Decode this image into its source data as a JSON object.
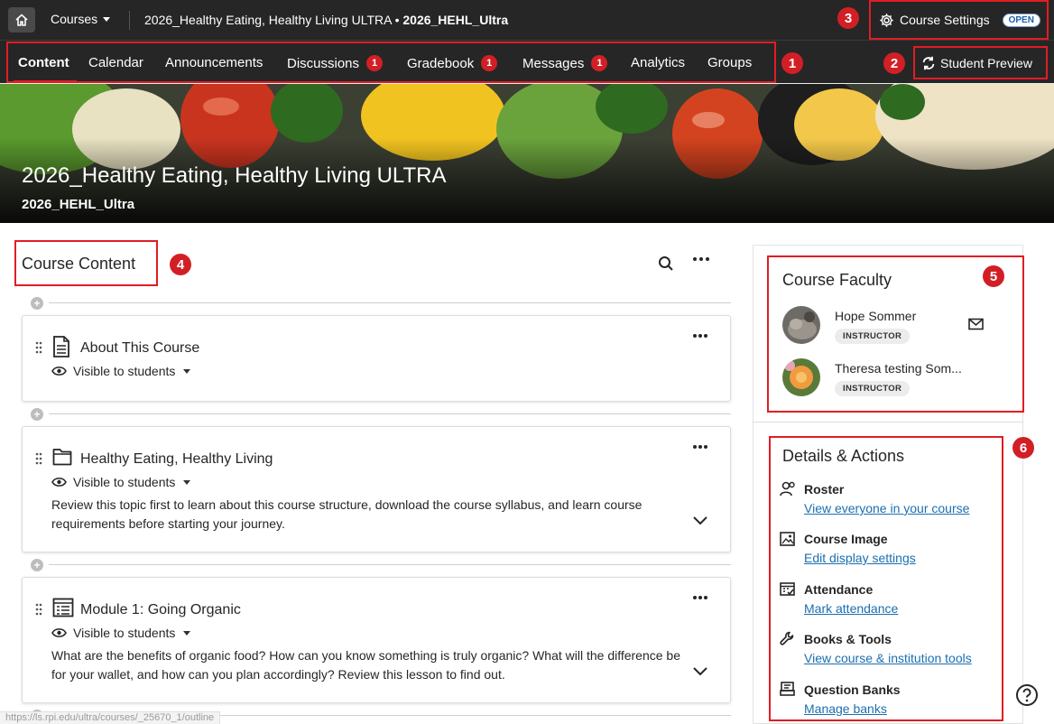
{
  "topbar": {
    "courses_label": "Courses",
    "breadcrumb_course": "2026_Healthy Eating, Healthy Living ULTRA",
    "breadcrumb_sep": " • ",
    "breadcrumb_code": "2026_HEHL_Ultra",
    "settings_label": "Course Settings",
    "open_badge": "OPEN"
  },
  "nav": {
    "items": [
      {
        "label": "Content"
      },
      {
        "label": "Calendar"
      },
      {
        "label": "Announcements"
      },
      {
        "label": "Discussions",
        "count": "1"
      },
      {
        "label": "Gradebook",
        "count": "1"
      },
      {
        "label": "Messages",
        "count": "1"
      },
      {
        "label": "Analytics"
      },
      {
        "label": "Groups"
      }
    ],
    "student_preview": "Student Preview"
  },
  "callouts": [
    "1",
    "2",
    "3",
    "4",
    "5",
    "6"
  ],
  "banner": {
    "title": "2026_Healthy Eating, Healthy Living ULTRA",
    "subtitle": "2026_HEHL_Ultra"
  },
  "content": {
    "title": "Course Content",
    "items": [
      {
        "title": "About This Course",
        "visibility": "Visible to students",
        "icon": "document-icon"
      },
      {
        "title": "Healthy Eating, Healthy Living",
        "visibility": "Visible to students",
        "icon": "folder-icon",
        "description": "Review this topic first to learn about this course structure, download the course syllabus, and learn course requirements before starting your journey."
      },
      {
        "title": "Module 1: Going Organic",
        "visibility": "Visible to students",
        "icon": "learning-module-icon",
        "description": "What are the benefits of organic food? How can you know something is truly organic? What will the difference be for your wallet, and how can you plan accordingly? Review this lesson to find out."
      }
    ]
  },
  "faculty": {
    "title": "Course Faculty",
    "members": [
      {
        "name": "Hope Sommer",
        "role": "INSTRUCTOR"
      },
      {
        "name": "Theresa testing Som...",
        "role": "INSTRUCTOR"
      }
    ]
  },
  "details": {
    "title": "Details & Actions",
    "items": [
      {
        "label": "Roster",
        "link": "View everyone in your course",
        "icon": "roster-icon"
      },
      {
        "label": "Course Image",
        "link": "Edit display settings",
        "icon": "image-icon"
      },
      {
        "label": "Attendance",
        "link": "Mark attendance",
        "icon": "attendance-icon"
      },
      {
        "label": "Books & Tools",
        "link": "View course & institution tools",
        "icon": "wrench-icon"
      },
      {
        "label": "Question Banks",
        "link": "Manage banks",
        "icon": "question-bank-icon"
      }
    ]
  },
  "status_url": "https://ls.rpi.edu/ultra/courses/_25670_1/outline",
  "colors": {
    "accent_red": "#e11d24",
    "topbar": "#262626",
    "link": "#1b6fb0"
  }
}
